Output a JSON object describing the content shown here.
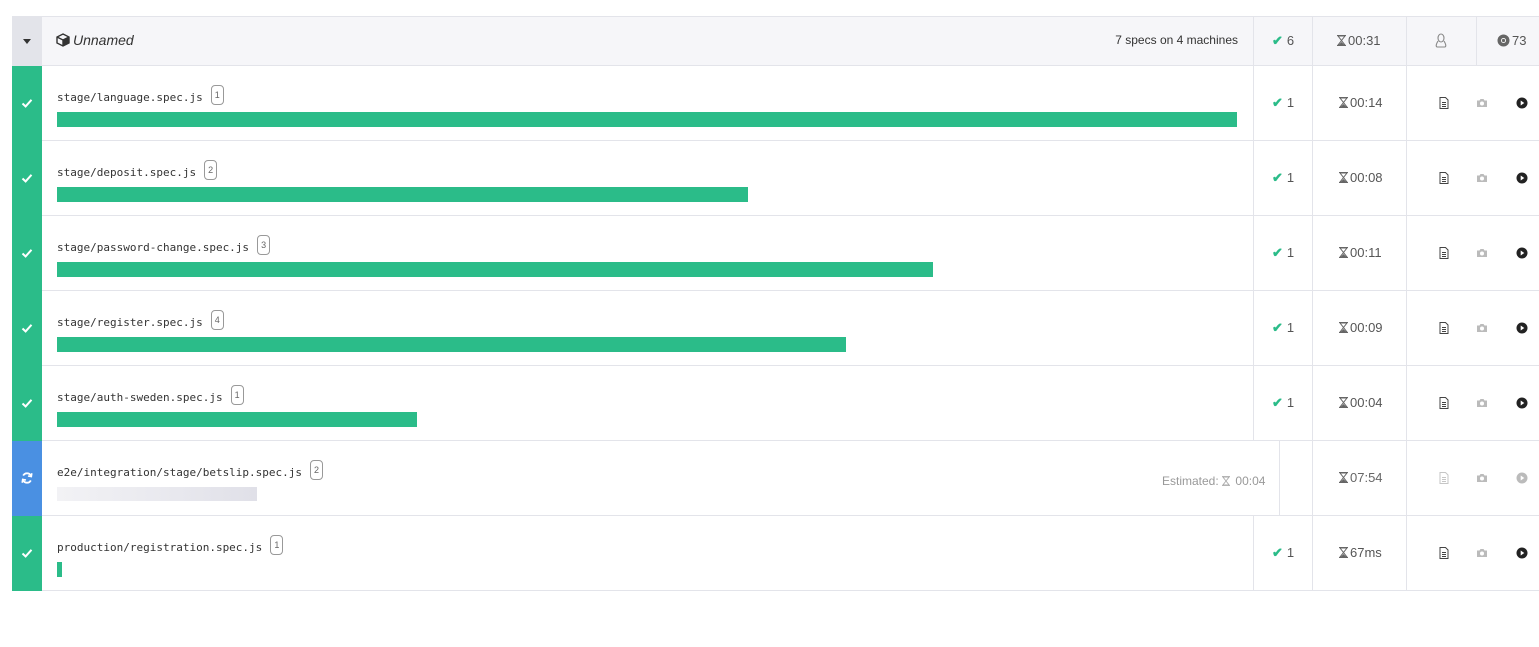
{
  "group": {
    "name": "Unnamed",
    "summary": "7 specs on 4 machines",
    "passed": "6",
    "duration": "00:31",
    "os_icon": "linux-icon",
    "browser_icon": "chrome-icon",
    "browser_version": "73"
  },
  "colors": {
    "passed": "#2bbc89",
    "running": "#4a90e2"
  },
  "specs": [
    {
      "name": "stage/language.spec.js",
      "machine": "1",
      "status": "passed",
      "passed": "1",
      "duration": "00:14",
      "progress": 1.0
    },
    {
      "name": "stage/deposit.spec.js",
      "machine": "2",
      "status": "passed",
      "passed": "1",
      "duration": "00:08",
      "progress": 0.586
    },
    {
      "name": "stage/password-change.spec.js",
      "machine": "3",
      "status": "passed",
      "passed": "1",
      "duration": "00:11",
      "progress": 0.742
    },
    {
      "name": "stage/register.spec.js",
      "machine": "4",
      "status": "passed",
      "passed": "1",
      "duration": "00:09",
      "progress": 0.669
    },
    {
      "name": "stage/auth-sweden.spec.js",
      "machine": "1",
      "status": "passed",
      "passed": "1",
      "duration": "00:04",
      "progress": 0.305
    },
    {
      "name": "e2e/integration/stage/betslip.spec.js",
      "machine": "2",
      "status": "running",
      "estimated_label": "Estimated:",
      "estimated": "00:04",
      "duration": "07:54",
      "progress": 0.17
    },
    {
      "name": "production/registration.spec.js",
      "machine": "1",
      "status": "passed",
      "passed": "1",
      "duration": "67ms",
      "progress": 0.004
    }
  ]
}
